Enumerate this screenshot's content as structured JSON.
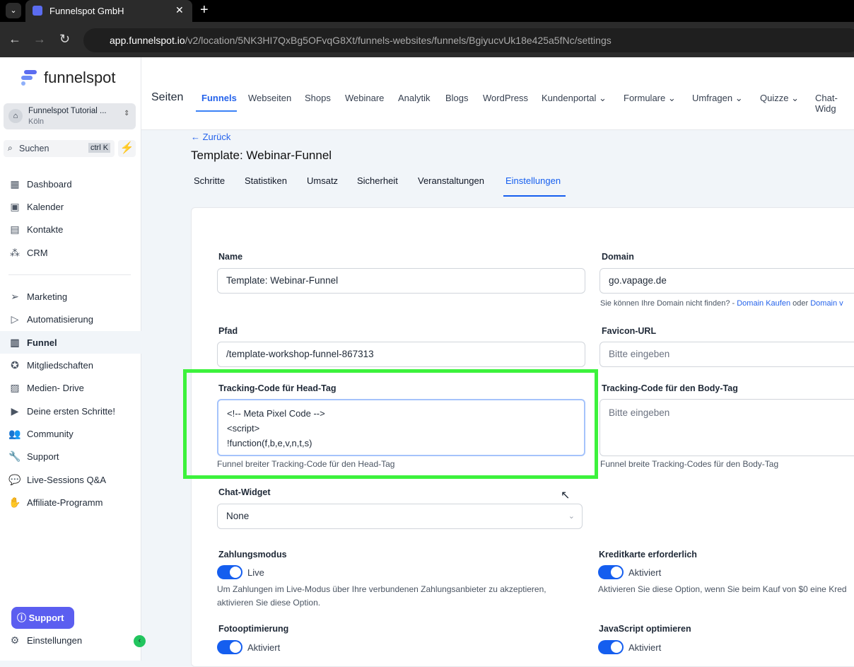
{
  "browser": {
    "tab_title": "Funnelspot GmbH",
    "url_host": "app.funnelspot.io",
    "url_path": "/v2/location/5NK3HI7QxBg5OFvqG8Xt/funnels-websites/funnels/BgiyucvUk18e425a5fNc/settings"
  },
  "sidebar": {
    "logo": "funnelspot",
    "account_name": "Funnelspot Tutorial ...",
    "account_city": "Köln",
    "search": "Suchen",
    "search_shortcut": "ctrl K",
    "items": [
      {
        "label": "Dashboard",
        "icon": "grid-icon"
      },
      {
        "label": "Kalender",
        "icon": "calendar-icon"
      },
      {
        "label": "Kontakte",
        "icon": "contacts-icon"
      },
      {
        "label": "CRM",
        "icon": "crm-icon"
      },
      {
        "label": "Marketing",
        "icon": "send-icon"
      },
      {
        "label": "Automatisierung",
        "icon": "automation-icon"
      },
      {
        "label": "Funnel",
        "icon": "funnel-icon"
      },
      {
        "label": "Mitgliedschaften",
        "icon": "badge-icon"
      },
      {
        "label": "Medien- Drive",
        "icon": "image-icon"
      },
      {
        "label": "Deine ersten Schritte!",
        "icon": "play-icon"
      },
      {
        "label": "Community",
        "icon": "users-icon"
      },
      {
        "label": "Support",
        "icon": "wrench-icon"
      },
      {
        "label": "Live-Sessions Q&A",
        "icon": "chat-icon"
      },
      {
        "label": "Affiliate-Programm",
        "icon": "hand-icon"
      }
    ],
    "support_button": "Support",
    "settings": "Einstellungen"
  },
  "topnav": {
    "title": "Seiten",
    "items": [
      "Funnels",
      "Webseiten",
      "Shops",
      "Webinare",
      "Analytik",
      "Blogs",
      "WordPress",
      "Kundenportal",
      "Formulare",
      "Umfragen",
      "Quizze",
      "Chat-Widg"
    ]
  },
  "page": {
    "back": "← Zurück",
    "title": "Template: Webinar-Funnel",
    "tabs": [
      "Schritte",
      "Statistiken",
      "Umsatz",
      "Sicherheit",
      "Veranstaltungen",
      "Einstellungen"
    ]
  },
  "form": {
    "name_label": "Name",
    "name_value": "Template: Webinar-Funnel",
    "domain_label": "Domain",
    "domain_value": "go.vapage.de",
    "domain_help": "Sie können Ihre Domain nicht finden? -",
    "domain_buy": "Domain Kaufen",
    "domain_or": "oder",
    "domain_link2": "Domain v",
    "path_label": "Pfad",
    "path_value": "/template-workshop-funnel-867313",
    "favicon_label": "Favicon-URL",
    "favicon_placeholder": "Bitte eingeben",
    "head_label": "Tracking-Code für Head-Tag",
    "head_lines": [
      "<!-- Meta Pixel Code -->",
      "<script>",
      "!function(f,b,e,v,n,t,s)"
    ],
    "head_help": "Funnel breiter Tracking-Code für den Head-Tag",
    "body_label": "Tracking-Code für den Body-Tag",
    "body_placeholder": "Bitte eingeben",
    "body_help": "Funnel breite Tracking-Codes für den Body-Tag",
    "chat_label": "Chat-Widget",
    "chat_value": "None",
    "pay_label": "Zahlungsmodus",
    "pay_value": "Live",
    "pay_help1": "Um Zahlungen im Live-Modus über Ihre verbundenen Zahlungsanbieter zu akzeptieren,",
    "pay_help2": "aktivieren Sie diese Option.",
    "cc_label": "Kreditkarte erforderlich",
    "cc_value": "Aktiviert",
    "cc_help": "Aktivieren Sie diese Option, wenn Sie beim Kauf von $0 eine Kred",
    "photo_label": "Fotooptimierung",
    "photo_value": "Aktiviert",
    "js_label": "JavaScript optimieren",
    "js_value": "Aktiviert"
  },
  "colors": {
    "accent": "#155eef",
    "highlight": "#3cf23c"
  }
}
